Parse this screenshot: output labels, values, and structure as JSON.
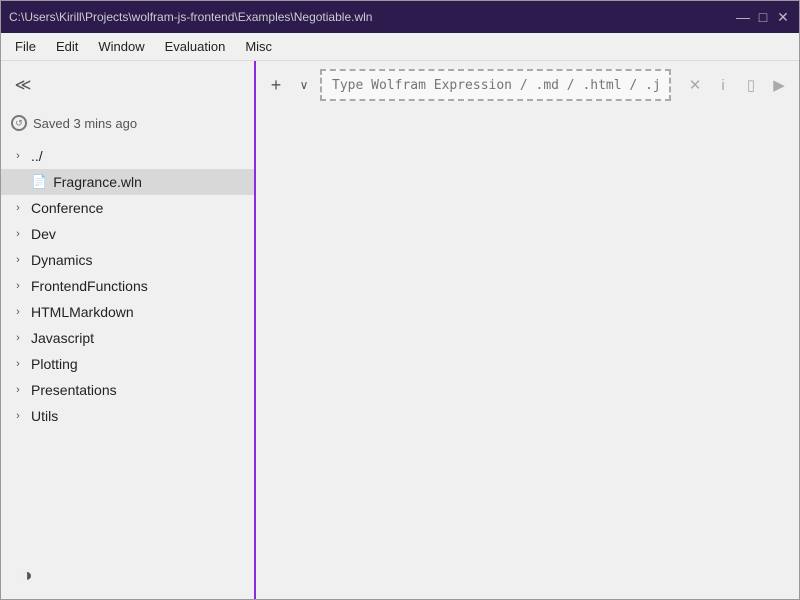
{
  "window": {
    "title": "C:\\Users\\Kirill\\Projects\\wolfram-js-frontend\\Examples\\Negotiable.wln",
    "controls": {
      "minimize": "—",
      "maximize": "□",
      "close": "✕"
    }
  },
  "menu": {
    "items": [
      "File",
      "Edit",
      "Window",
      "Evaluation",
      "Misc"
    ]
  },
  "sidebar": {
    "collapse_icon": "≪",
    "saved_status": "Saved 3 mins ago",
    "tree": [
      {
        "type": "folder",
        "label": "../",
        "indent": 0
      },
      {
        "type": "file",
        "label": "Fragrance.wln",
        "indent": 1,
        "selected": true
      },
      {
        "type": "folder",
        "label": "Conference",
        "indent": 1
      },
      {
        "type": "folder",
        "label": "Dev",
        "indent": 1
      },
      {
        "type": "folder",
        "label": "Dynamics",
        "indent": 1
      },
      {
        "type": "folder",
        "label": "FrontendFunctions",
        "indent": 1
      },
      {
        "type": "folder",
        "label": "HTMLMarkdown",
        "indent": 1
      },
      {
        "type": "folder",
        "label": "Javascript",
        "indent": 1
      },
      {
        "type": "folder",
        "label": "Plotting",
        "indent": 1
      },
      {
        "type": "folder",
        "label": "Presentations",
        "indent": 1
      },
      {
        "type": "folder",
        "label": "Utils",
        "indent": 1
      }
    ],
    "theme_toggle": "◑"
  },
  "editor": {
    "add_button": "+",
    "dropdown_arrow": "∨",
    "expression_placeholder": "Type Wolfram Expression / .md / .html / .js",
    "action_close": "✕",
    "action_info": "i",
    "action_expand": "▯",
    "action_run": "▶"
  }
}
